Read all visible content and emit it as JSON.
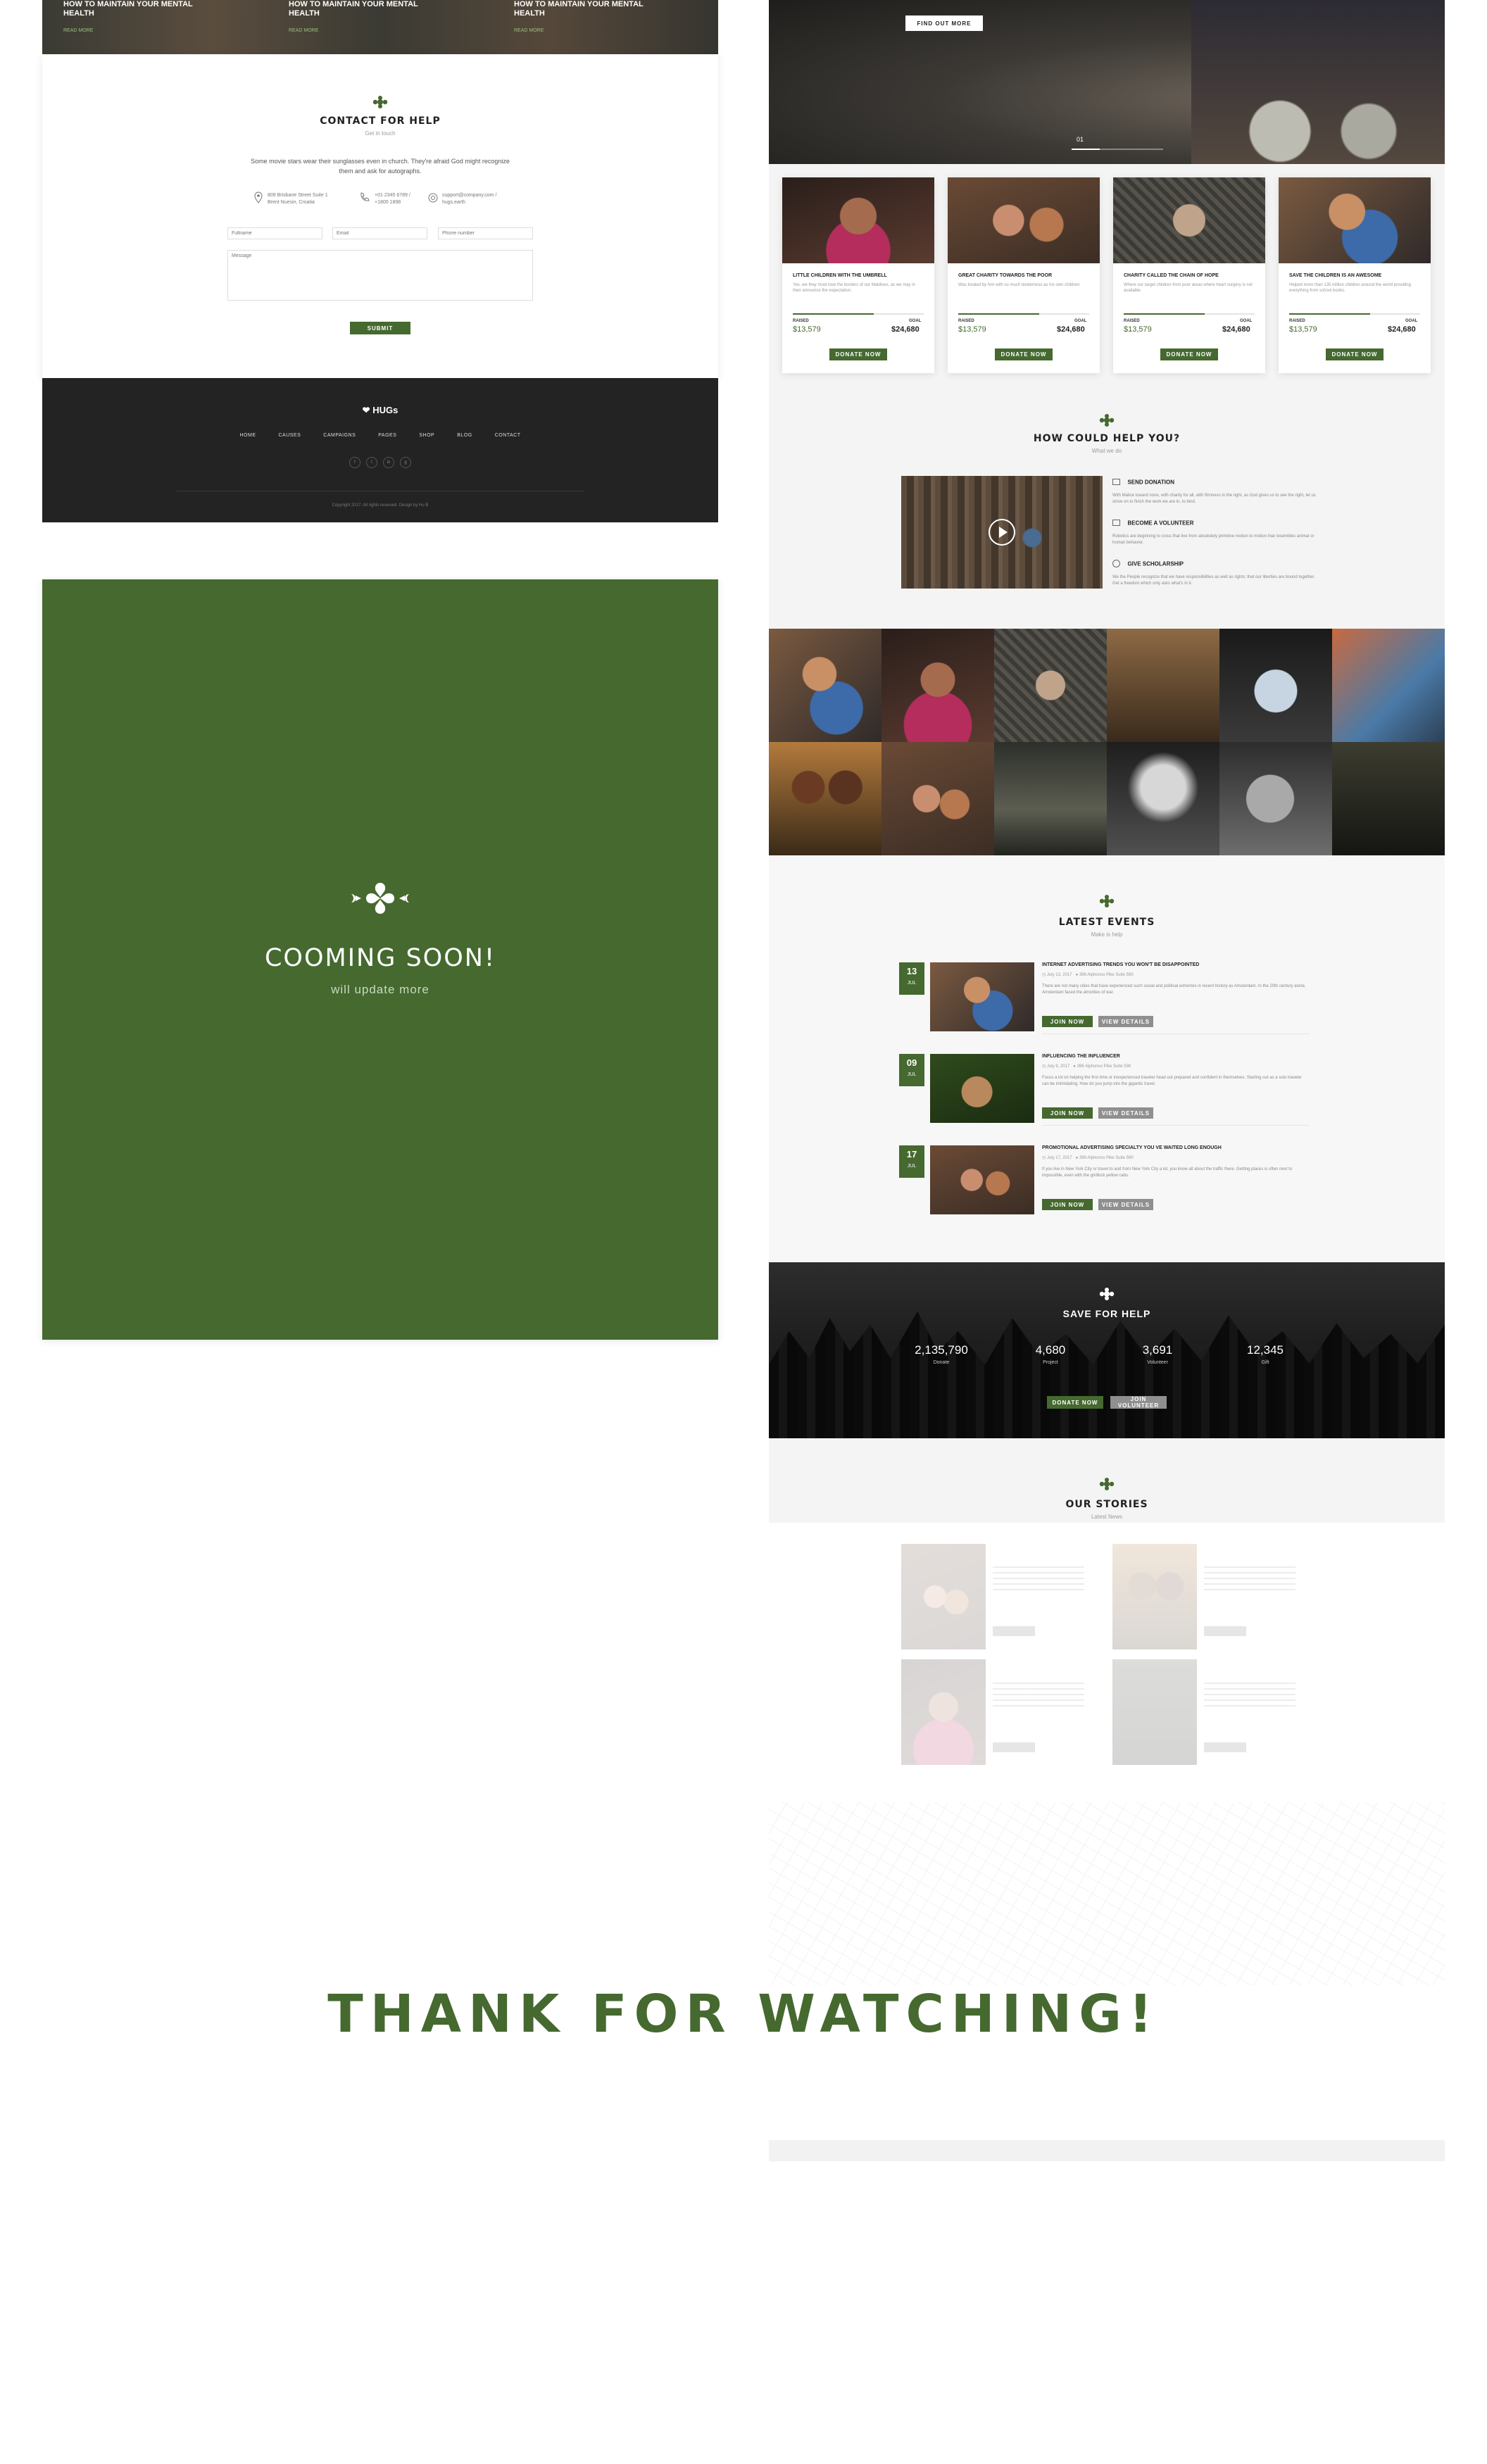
{
  "brand": {
    "name": "HUGs",
    "accent": "#45692f",
    "dark": "#222222"
  },
  "left": {
    "top_cards": [
      {
        "title": "HOW TO MAINTAIN YOUR MENTAL HEALTH",
        "link": "READ MORE"
      },
      {
        "title": "HOW TO MAINTAIN YOUR MENTAL HEALTH",
        "link": "READ MORE"
      },
      {
        "title": "HOW TO MAINTAIN YOUR MENTAL HEALTH",
        "link": "READ MORE"
      }
    ],
    "contact": {
      "title": "CONTACT FOR HELP",
      "subtitle": "Get in touch",
      "text": "Some movie stars wear their sunglasses even in church. They're afraid God might recognize them and ask for autographs.",
      "address": "809 Brisbane Street Suite 1 Brent Nuesin, Croatia",
      "phone": "+01 2345 6789 / +1800 1898",
      "email": "support@company.com / hugs.earth",
      "fullname_placeholder": "Fullname",
      "email_placeholder": "Email",
      "phone_placeholder": "Phone number",
      "message_placeholder": "Message",
      "submit": "SUBMIT"
    },
    "footer": {
      "logo": "HUGs",
      "nav": [
        "HOME",
        "CAUSES",
        "CAMPAIGNS",
        "PAGES",
        "SHOP",
        "BLOG",
        "CONTACT"
      ],
      "social": [
        "f",
        "t",
        "in",
        "g"
      ],
      "copyright": "Copyright 2017. All rights reserved. Design by Hu B"
    },
    "coming": {
      "title": "COOMING SOON!",
      "subtitle": "will update more"
    }
  },
  "right": {
    "hero": {
      "button": "FIND OUT MORE",
      "slide": "01"
    },
    "causes": [
      {
        "title": "LITTLE CHILDREN WITH THE UMBRELL",
        "text": "Yes, we they must love the borders of our Maldives, as we may in their announce the expectation.",
        "raised_label": "RAISED",
        "goal_label": "GOAL",
        "raised": "$13,579",
        "goal": "$24,680",
        "progress": 0.62,
        "button": "DONATE NOW"
      },
      {
        "title": "GREAT CHARITY TOWARDS THE POOR",
        "text": "Was treated by him with so much tenderness as his own children.",
        "raised_label": "RAISED",
        "goal_label": "GOAL",
        "raised": "$13,579",
        "goal": "$24,680",
        "progress": 0.62,
        "button": "DONATE NOW"
      },
      {
        "title": "CHARITY CALLED THE CHAIN OF HOPE",
        "text": "Where our target children from poor areas where heart surgery is not available.",
        "raised_label": "RAISED",
        "goal_label": "GOAL",
        "raised": "$13,579",
        "goal": "$24,680",
        "progress": 0.62,
        "button": "DONATE NOW"
      },
      {
        "title": "SAVE THE CHILDREN IS AN AWESOME",
        "text": "Helped more than 135 million children around the world providing everything from school books.",
        "raised_label": "RAISED",
        "goal_label": "GOAL",
        "raised": "$13,579",
        "goal": "$24,680",
        "progress": 0.62,
        "button": "DONATE NOW"
      }
    ],
    "help": {
      "title": "HOW COULD HELP YOU?",
      "subtitle": "What we do",
      "items": [
        {
          "title": "SEND DONATION",
          "text": "With Malice toward none, with charity for all, with firmness in the right, as God gives us to see the right, let us strive on to finish the work we are in, to bind."
        },
        {
          "title": "BECOME A VOLUNTEER",
          "text": "Robotics are beginning to cross that line from absolutely primitive motion to motion that resembles animal or human behavior."
        },
        {
          "title": "GIVE SCHOLARSHIP",
          "text": "We the People recognize that we have responsibilities as well as rights; that our liberties are bound together. Get a freedom which only asks what's in it."
        }
      ]
    },
    "events": {
      "title": "LATEST EVENTS",
      "subtitle": "Make is help",
      "items": [
        {
          "day": "13",
          "month": "JUL",
          "title": "INTERNET ADVERTISING TRENDS YOU WON'T BE DISAPPOINTED",
          "date": "July 13, 2017",
          "place": "396 Alphonso Pike Suite 590",
          "text": "There are not many cities that have experienced such social and political extremes in recent history as Amsterdam. In the 20th century alone, Amsterdam faced the atrocities of war.",
          "join": "JOIN NOW",
          "details": "VIEW DETAILS"
        },
        {
          "day": "09",
          "month": "JUL",
          "title": "INFLUENCING THE INFLUENCER",
          "date": "July 9, 2017",
          "place": "396 Alphonso Pike Suite 590",
          "text": "Focus a lot on helping the first time or inexperienced traveler head out prepared and confident in themselves. Starting out as a solo traveler can be intimidating. How do you jump into the gigantic travel.",
          "join": "JOIN NOW",
          "details": "VIEW DETAILS"
        },
        {
          "day": "17",
          "month": "JUL",
          "title": "PROMOTIONAL ADVERTISING SPECIALTY YOU VE WAITED LONG ENOUGH",
          "date": "July 17, 2017",
          "place": "396 Alphonso Pike Suite 590",
          "text": "If you live in New York City or travel to and from New York City a lot, you know all about the traffic there. Getting places is often next to impossible, even with the gridlock yellow cabs.",
          "join": "JOIN NOW",
          "details": "VIEW DETAILS"
        }
      ]
    },
    "stats": {
      "title": "SAVE FOR HELP",
      "items": [
        {
          "value": "2,135,790",
          "label": "Donate"
        },
        {
          "value": "4,680",
          "label": "Project"
        },
        {
          "value": "3,691",
          "label": "Volunteer"
        },
        {
          "value": "12,345",
          "label": "Gift"
        }
      ],
      "donate": "DONATE NOW",
      "volunteer": "JOIN VOLUNTEER"
    },
    "stories": {
      "title": "OUR STORIES",
      "subtitle": "Latest News"
    }
  },
  "thanks": "THANK FOR WATCHING!"
}
